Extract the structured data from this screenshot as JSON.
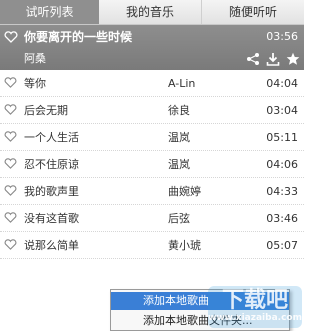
{
  "tabs": [
    {
      "label": "试听列表",
      "active": true
    },
    {
      "label": "我的音乐",
      "active": false
    },
    {
      "label": "随便听听",
      "active": false
    }
  ],
  "now_playing": {
    "title": "你要离开的一些时候",
    "artist": "阿桑",
    "time": "03:56",
    "icons": [
      "heart-icon",
      "share-icon",
      "download-icon",
      "star-icon"
    ]
  },
  "songs": [
    {
      "name": "等你",
      "singer": "A-Lin",
      "duration": "04:04"
    },
    {
      "name": "后会无期",
      "singer": "徐良",
      "duration": "03:04"
    },
    {
      "name": "一个人生活",
      "singer": "温岚",
      "duration": "05:11"
    },
    {
      "name": "忍不住原谅",
      "singer": "温岚",
      "duration": "04:06"
    },
    {
      "name": "我的歌声里",
      "singer": "曲婉婷",
      "duration": "04:33"
    },
    {
      "name": "没有这首歌",
      "singer": "后弦",
      "duration": "03:46"
    },
    {
      "name": "说那么简单",
      "singer": "黄小琥",
      "duration": "05:07"
    }
  ],
  "context_menu": {
    "items": [
      "添加本地歌曲",
      "添加本地歌曲文件夹..."
    ]
  },
  "watermark": {
    "text": "下载吧",
    "sub": "www.xiazaiba.com"
  },
  "colors": {
    "tab_active": "#8f8f8f",
    "now_playing_bg": "#7a7a7a",
    "menu_highlight": "#3a7fd6"
  }
}
